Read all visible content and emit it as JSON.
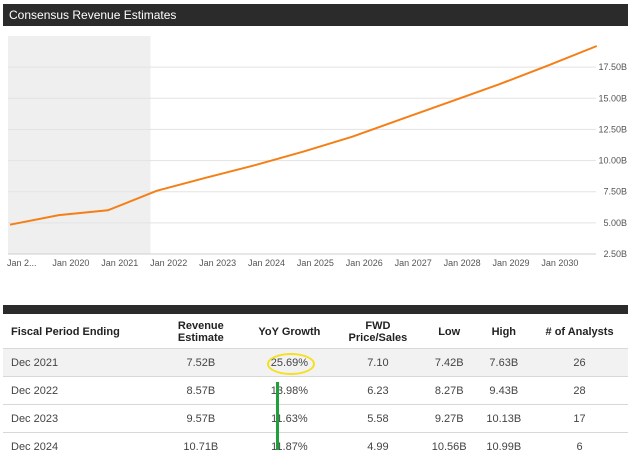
{
  "header": {
    "title": "Consensus Revenue Estimates"
  },
  "chart_data": {
    "type": "line",
    "series": [
      {
        "color": "#f57f17",
        "points": [
          [
            "2019-01-01",
            4.85
          ],
          [
            "2020-01-01",
            5.62
          ],
          [
            "2021-01-01",
            6.01
          ],
          [
            "2022-01-01",
            7.57
          ],
          [
            "2023-01-01",
            8.62
          ],
          [
            "2024-01-01",
            9.62
          ],
          [
            "2025-01-01",
            10.72
          ],
          [
            "2026-01-01",
            11.92
          ],
          [
            "2027-01-01",
            13.32
          ],
          [
            "2028-01-01",
            14.72
          ],
          [
            "2029-01-01",
            16.12
          ],
          [
            "2030-01-01",
            17.62
          ],
          [
            "2031-01-01",
            19.2
          ]
        ]
      }
    ],
    "x_ticks": [
      "Jan 2...",
      "Jan 2020",
      "Jan 2021",
      "Jan 2022",
      "Jan 2023",
      "Jan 2024",
      "Jan 2025",
      "Jan 2026",
      "Jan 2027",
      "Jan 2028",
      "Jan 2029",
      "Jan 2030"
    ],
    "y_ticks": [
      "2.50B",
      "5.00B",
      "7.50B",
      "10.00B",
      "12.50B",
      "15.00B",
      "17.50B"
    ],
    "ylim": [
      2.5,
      20
    ],
    "historical_shading_until": "2021-11-15",
    "grid": true
  },
  "table": {
    "headers": [
      "Fiscal Period Ending",
      "Revenue Estimate",
      "YoY Growth",
      "FWD Price/Sales",
      "Low",
      "High",
      "# of Analysts"
    ],
    "rows": [
      [
        "Dec 2021",
        "7.52B",
        "25.69%",
        "7.10",
        "7.42B",
        "7.63B",
        "26"
      ],
      [
        "Dec 2022",
        "8.57B",
        "13.98%",
        "6.23",
        "8.27B",
        "9.43B",
        "28"
      ],
      [
        "Dec 2023",
        "9.57B",
        "11.63%",
        "5.58",
        "9.27B",
        "10.13B",
        "17"
      ],
      [
        "Dec 2024",
        "10.71B",
        "11.87%",
        "4.99",
        "10.56B",
        "10.99B",
        "6"
      ]
    ]
  },
  "annotations": {
    "circle_color": "#f5e020",
    "bar_color": "#1fa03c"
  }
}
